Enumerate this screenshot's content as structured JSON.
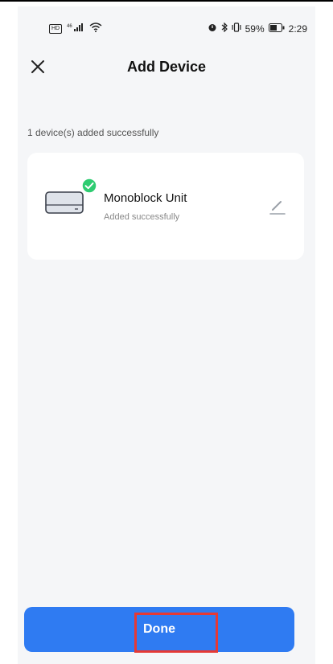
{
  "status_bar": {
    "hd_badge": "HD",
    "signal": "⁴⁶.ıll",
    "wifi": "📶",
    "right_icons": "⏰ ∦ ıĿı",
    "battery_percent": "59%",
    "time": "2:29"
  },
  "header": {
    "title": "Add Device",
    "close_icon": "close-icon"
  },
  "summary_text": "1 device(s) added successfully",
  "devices": [
    {
      "name": "Monoblock Unit",
      "status": "Added successfully",
      "icon": "air-conditioner-icon",
      "badge_icon": "check-circle-icon",
      "edit_icon": "pencil-icon"
    }
  ],
  "footer": {
    "done_label": "Done"
  },
  "colors": {
    "accent": "#2f7bf2",
    "success": "#2ecc71",
    "background": "#f5f6f8",
    "highlight": "#e53935"
  }
}
